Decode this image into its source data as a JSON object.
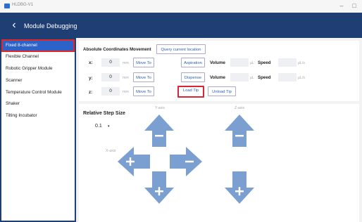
{
  "window": {
    "title": "HLDBG-V1"
  },
  "header": {
    "title": "Module Debugging"
  },
  "sidebar": {
    "items": [
      {
        "label": "Fixed 8-channel"
      },
      {
        "label": "Flexible Channel"
      },
      {
        "label": "Robotic Gripper Module"
      },
      {
        "label": "Scanner"
      },
      {
        "label": "Temperature Control Module"
      },
      {
        "label": "Shaker"
      },
      {
        "label": "Tilting Incubator"
      }
    ]
  },
  "movement": {
    "title": "Absolute Coordinates Movement",
    "query_label": "Query current location",
    "rows": [
      {
        "axis": "x:",
        "value": "0",
        "unit": "mm",
        "move_label": "Move To"
      },
      {
        "axis": "y:",
        "value": "0",
        "unit": "mm",
        "move_label": "Move To"
      },
      {
        "axis": "z:",
        "value": "0",
        "unit": "mm",
        "move_label": "Move To"
      }
    ]
  },
  "pipette": {
    "aspiration_label": "Aspiration",
    "dispense_label": "Dispense",
    "volume_label": "Volume",
    "volume_unit": "µL",
    "speed_label": "Speed",
    "speed_unit": "µL/s",
    "load_tip_label": "Load Tip",
    "unload_tip_label": "Unload Tip"
  },
  "step": {
    "title": "Relative Step Size",
    "selected": "0.1",
    "caret": "▾"
  },
  "axes": {
    "y_label": "Y-axis",
    "z_label": "Z-axis",
    "x_label": "X-axis"
  },
  "colors": {
    "header": "#1e3e74",
    "active_item": "#2d63c8",
    "highlight": "#d9253a",
    "arrow": "#7a9fd0"
  }
}
